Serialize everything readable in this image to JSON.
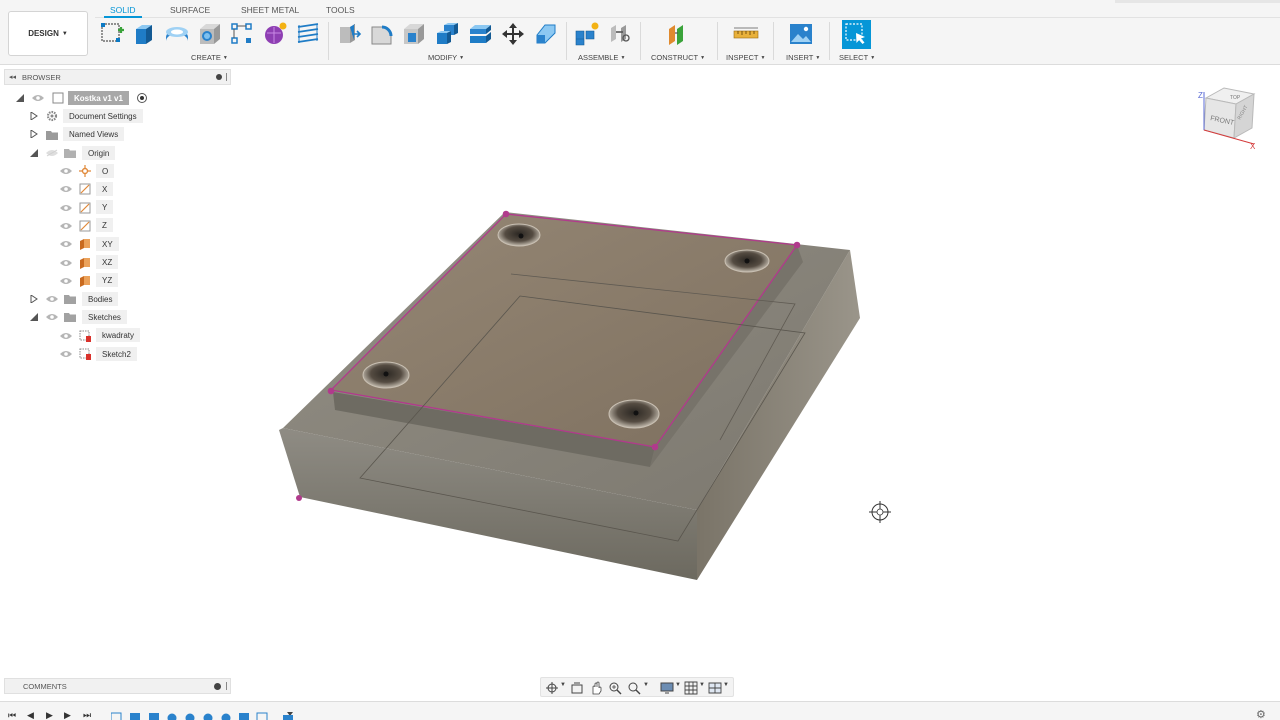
{
  "toolbar": {
    "workspace": "DESIGN",
    "tabs": [
      {
        "label": "SOLID",
        "active": true
      },
      {
        "label": "SURFACE",
        "active": false
      },
      {
        "label": "SHEET METAL",
        "active": false
      },
      {
        "label": "TOOLS",
        "active": false
      }
    ],
    "groups": {
      "create": "CREATE",
      "modify": "MODIFY",
      "assemble": "ASSEMBLE",
      "construct": "CONSTRUCT",
      "inspect": "INSPECT",
      "insert": "INSERT",
      "select": "SELECT"
    },
    "accent": "#0696d7"
  },
  "browser": {
    "title": "BROWSER",
    "root": "Kostka v1 v1",
    "items": [
      {
        "label": "Document Settings",
        "icon": "gear-icon"
      },
      {
        "label": "Named Views",
        "icon": "folder-icon"
      },
      {
        "label": "Origin",
        "icon": "folder-icon"
      },
      {
        "label": "O",
        "icon": "origin-point-icon"
      },
      {
        "label": "X",
        "icon": "axis-icon"
      },
      {
        "label": "Y",
        "icon": "axis-icon"
      },
      {
        "label": "Z",
        "icon": "axis-icon"
      },
      {
        "label": "XY",
        "icon": "plane-icon"
      },
      {
        "label": "XZ",
        "icon": "plane-icon"
      },
      {
        "label": "YZ",
        "icon": "plane-icon"
      },
      {
        "label": "Bodies",
        "icon": "folder-icon"
      },
      {
        "label": "Sketches",
        "icon": "folder-icon"
      },
      {
        "label": "kwadraty",
        "icon": "sketch-icon"
      },
      {
        "label": "Sketch2",
        "icon": "sketch-icon"
      }
    ]
  },
  "viewcube": {
    "top": "TOP",
    "front": "FRONT",
    "right": "RIGHT",
    "axis_z": "Z",
    "axis_x": "X"
  },
  "comments": {
    "title": "COMMENTS"
  }
}
